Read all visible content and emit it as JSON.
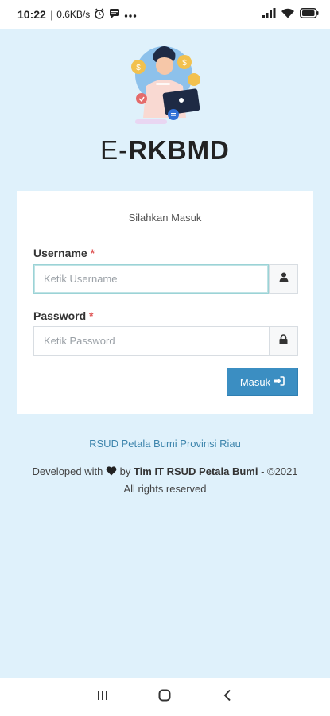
{
  "status_bar": {
    "time": "10:22",
    "speed": "0.6KB/s",
    "icons": [
      "alarm-icon",
      "message-icon",
      "more-dots-icon",
      "signal-icon",
      "wifi-icon",
      "battery-icon"
    ]
  },
  "app": {
    "title_prefix": "E-",
    "title_main": "RKBMD"
  },
  "login_card": {
    "heading": "Silahkan Masuk",
    "username_label": "Username",
    "username_required": "*",
    "username_placeholder": "Ketik Username",
    "username_value": "",
    "username_icon": "user-icon",
    "password_label": "Password",
    "password_required": "*",
    "password_placeholder": "Ketik Password",
    "password_value": "",
    "password_icon": "lock-icon",
    "submit_label": "Masuk",
    "submit_icon": "sign-in-icon"
  },
  "footer": {
    "org_link": "RSUD Petala Bumi Provinsi Riau",
    "developed_with": "Developed with",
    "by": "by",
    "team": "Tim IT RSUD Petala Bumi",
    "year": "- ©2021",
    "rights": "All rights reserved"
  },
  "colors": {
    "background": "#dff1fb",
    "primary_button": "#3b8ec2",
    "link": "#3f86ad",
    "required": "#e05a5a"
  },
  "nav_bar": {
    "icons": [
      "recents-icon",
      "home-icon",
      "back-icon"
    ]
  }
}
